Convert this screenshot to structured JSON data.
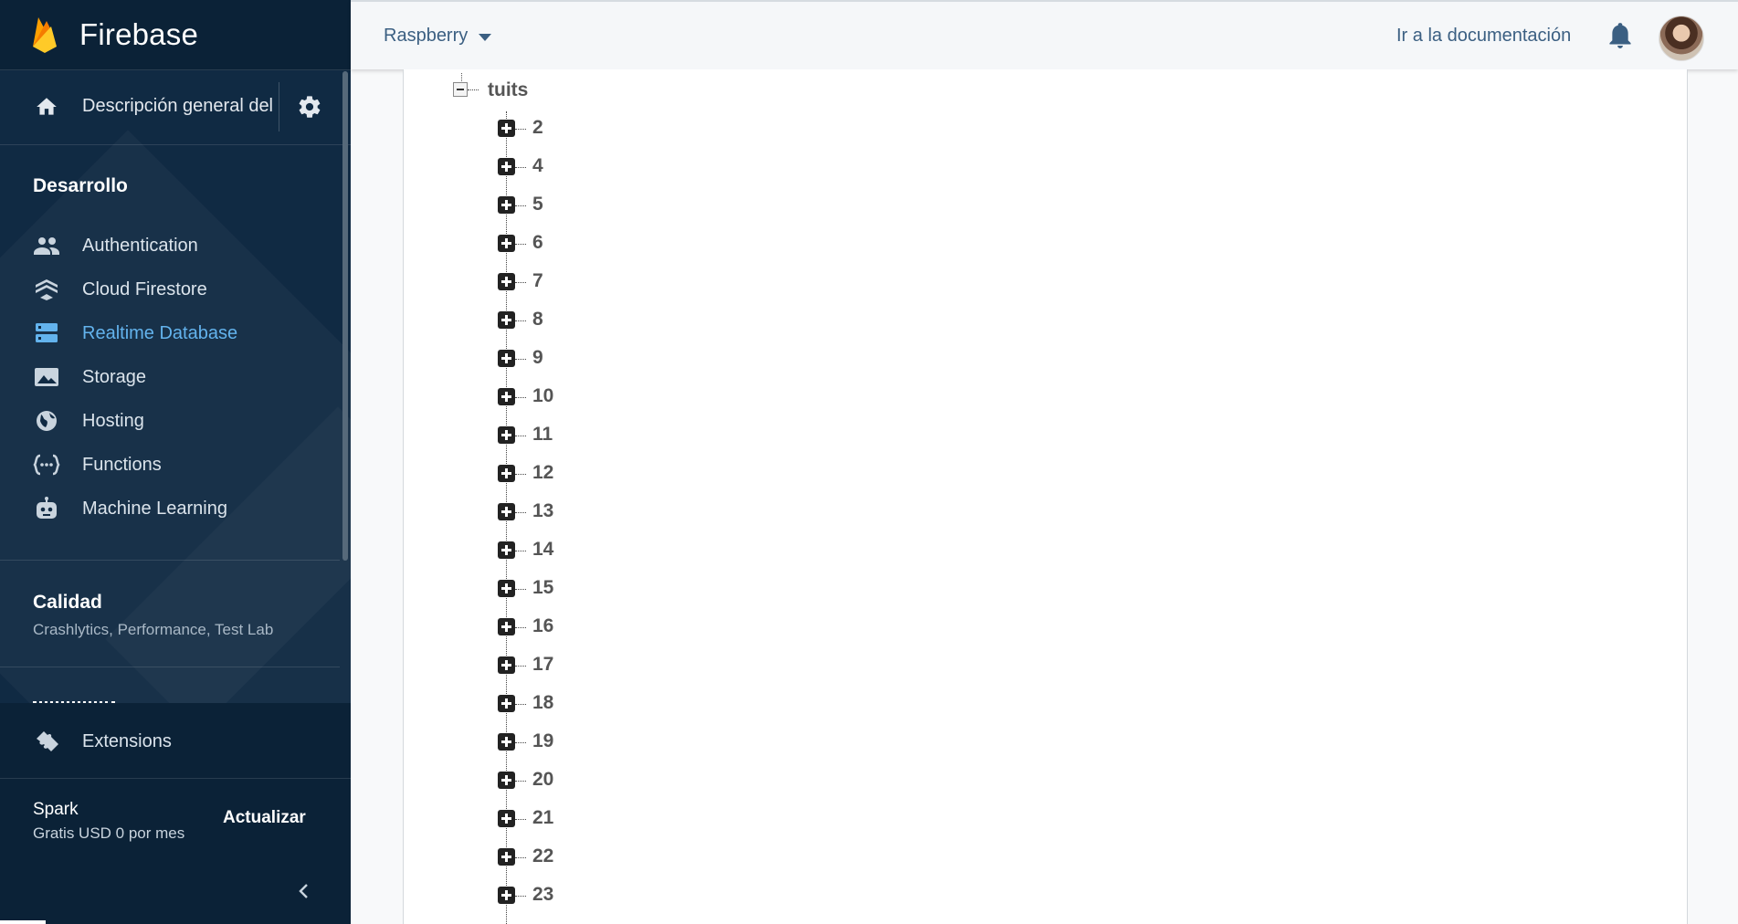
{
  "brand": {
    "name": "Firebase"
  },
  "overview": {
    "label": "Descripción general del proyecto"
  },
  "sidebar": {
    "section_title": "Desarrollo",
    "items": [
      {
        "label": "Authentication",
        "icon": "people-icon"
      },
      {
        "label": "Cloud Firestore",
        "icon": "firestore-icon"
      },
      {
        "label": "Realtime Database",
        "icon": "database-icon",
        "active": true
      },
      {
        "label": "Storage",
        "icon": "image-icon"
      },
      {
        "label": "Hosting",
        "icon": "globe-icon"
      },
      {
        "label": "Functions",
        "icon": "functions-icon"
      },
      {
        "label": "Machine Learning",
        "icon": "robot-icon"
      }
    ],
    "quality_title": "Calidad",
    "quality_subtitle": "Crashlytics, Performance, Test Lab",
    "extensions_label": "Extensions",
    "plan_name": "Spark",
    "plan_price": "Gratis USD 0 por mes",
    "upgrade_label": "Actualizar",
    "active_color": "#63b3ed",
    "background_color": "#102a43"
  },
  "topbar": {
    "project": "Raspberry",
    "docs_link": "Ir a la documentación"
  },
  "tree": {
    "root_label": "tuits",
    "children": [
      "2",
      "4",
      "5",
      "6",
      "7",
      "8",
      "9",
      "10",
      "11",
      "12",
      "13",
      "14",
      "15",
      "16",
      "17",
      "18",
      "19",
      "20",
      "21",
      "22",
      "23"
    ]
  }
}
